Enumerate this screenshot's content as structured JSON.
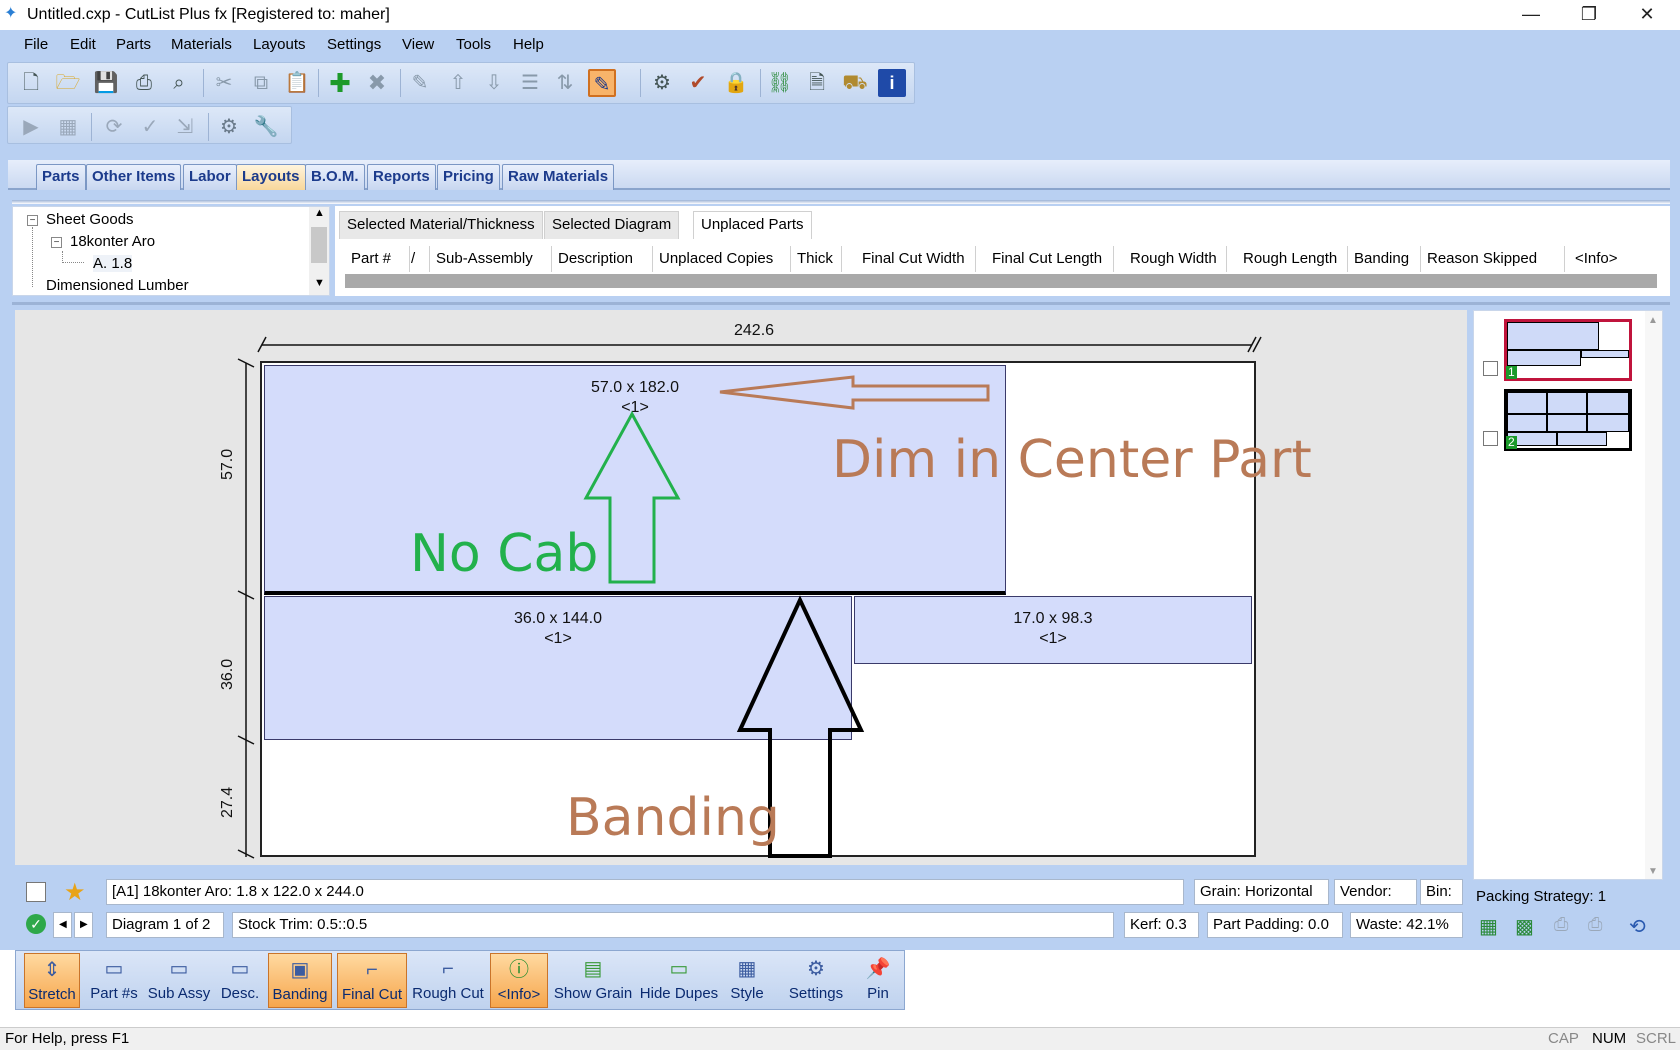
{
  "window": {
    "title": "Untitled.cxp - CutList Plus fx [Registered to: maher]",
    "minimize_glyph": "—",
    "maximize_glyph": "❐",
    "close_glyph": "✕"
  },
  "menu": [
    "File",
    "Edit",
    "Parts",
    "Materials",
    "Layouts",
    "Settings",
    "View",
    "Tools",
    "Help"
  ],
  "main_tabs": [
    "Parts",
    "Other Items",
    "Labor",
    "Layouts",
    "B.O.M.",
    "Reports",
    "Pricing",
    "Raw Materials"
  ],
  "active_main_tab": "Layouts",
  "tree": {
    "root": "Sheet Goods",
    "material": "18konter Aro",
    "thickness": "A. 1.8",
    "other": "Dimensioned Lumber"
  },
  "panel_tabs": [
    "Selected Material/Thickness",
    "Selected Diagram",
    "Unplaced Parts"
  ],
  "active_panel_tab": "Unplaced Parts",
  "grid_columns": [
    "Part #",
    "/",
    "Sub-Assembly",
    "Description",
    "Unplaced Copies",
    "Thick",
    "Final Cut Width",
    "Final Cut Length",
    "Rough Width",
    "Rough Length",
    "Banding",
    "Reason Skipped",
    "<Info>"
  ],
  "diagram": {
    "top_dim": "242.6",
    "left_dims": [
      "57.0",
      "36.0",
      "27.4"
    ],
    "parts": [
      {
        "size": "57.0 x 182.0",
        "copies": "<1>"
      },
      {
        "size": "36.0 x 144.0",
        "copies": "<1>"
      },
      {
        "size": "17.0 x 98.3",
        "copies": "<1>"
      }
    ]
  },
  "annotations": {
    "center": "Dim in Center Part",
    "nocab": "No Cab",
    "banding": "Banding",
    "colors": {
      "brown": "#b97a57",
      "green": "#22b14c"
    }
  },
  "thumbnails": [
    "1",
    "2"
  ],
  "packing_strategy": "Packing Strategy: 1",
  "info_bar": {
    "sheet": "[A1] 18konter Aro: 1.8 x 122.0 x 244.0",
    "grain": "Grain: Horizontal",
    "vendor": "Vendor:",
    "bin": "Bin:",
    "diagram": "Diagram 1 of 2",
    "stock_trim": "Stock Trim: 0.5::0.5",
    "kerf": "Kerf: 0.3",
    "padding": "Part Padding: 0.0",
    "waste": "Waste: 42.1%"
  },
  "bottom_toolbar": [
    {
      "label": "Stretch",
      "hl": true
    },
    {
      "label": "Part #s",
      "hl": false
    },
    {
      "label": "Sub Assy",
      "hl": false
    },
    {
      "label": "Desc.",
      "hl": false
    },
    {
      "label": "Banding",
      "hl": true
    },
    {
      "label": "Final Cut",
      "hl": true
    },
    {
      "label": "Rough Cut",
      "hl": false
    },
    {
      "label": "<Info>",
      "hl": true
    },
    {
      "label": "Show Grain",
      "hl": false
    },
    {
      "label": "Hide Dupes",
      "hl": false
    },
    {
      "label": "Style",
      "hl": false
    },
    {
      "label": "Settings",
      "hl": false
    },
    {
      "label": "Pin",
      "hl": false
    }
  ],
  "status": {
    "help": "For Help, press F1",
    "cap": "CAP",
    "num": "NUM",
    "scrl": "SCRL"
  }
}
